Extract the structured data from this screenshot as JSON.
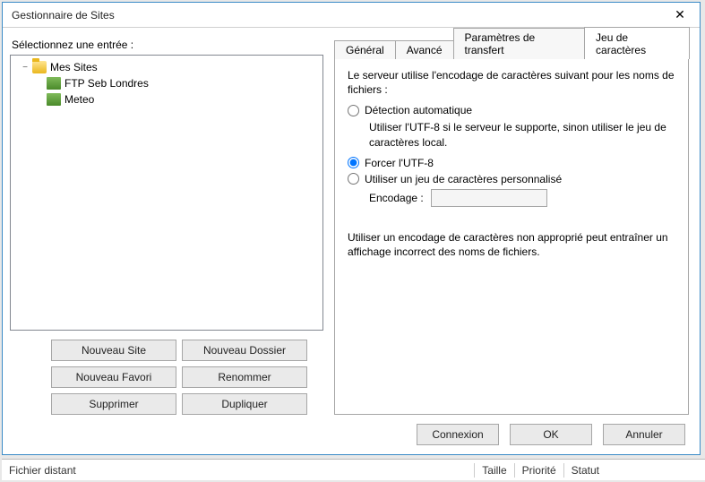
{
  "dialog": {
    "title": "Gestionnaire de Sites",
    "select_label": "Sélectionnez une entrée :"
  },
  "tree": {
    "root": "Mes Sites",
    "items": [
      {
        "label": "FTP Seb Londres"
      },
      {
        "label": "Meteo"
      }
    ]
  },
  "buttons": {
    "new_site": "Nouveau Site",
    "new_folder": "Nouveau Dossier",
    "new_bookmark": "Nouveau Favori",
    "rename": "Renommer",
    "delete": "Supprimer",
    "duplicate": "Dupliquer"
  },
  "tabs": {
    "general": "Général",
    "advanced": "Avancé",
    "transfer": "Paramètres de transfert",
    "charset": "Jeu de caractères"
  },
  "panel": {
    "intro": "Le serveur utilise l'encodage de caractères suivant pour les noms de fichiers :",
    "auto": "Détection automatique",
    "auto_sub": "Utiliser l'UTF-8 si le serveur le supporte, sinon utiliser le jeu de caractères local.",
    "force": "Forcer l'UTF-8",
    "custom": "Utiliser un jeu de caractères personnalisé",
    "encoding_label": "Encodage :",
    "encoding_value": "",
    "warning": "Utiliser un encodage de caractères non approprié peut entraîner un affichage incorrect des noms de fichiers."
  },
  "actions": {
    "connect": "Connexion",
    "ok": "OK",
    "cancel": "Annuler"
  },
  "statusbar": {
    "remote_file": "Fichier distant",
    "size": "Taille",
    "priority": "Priorité",
    "status": "Statut"
  }
}
